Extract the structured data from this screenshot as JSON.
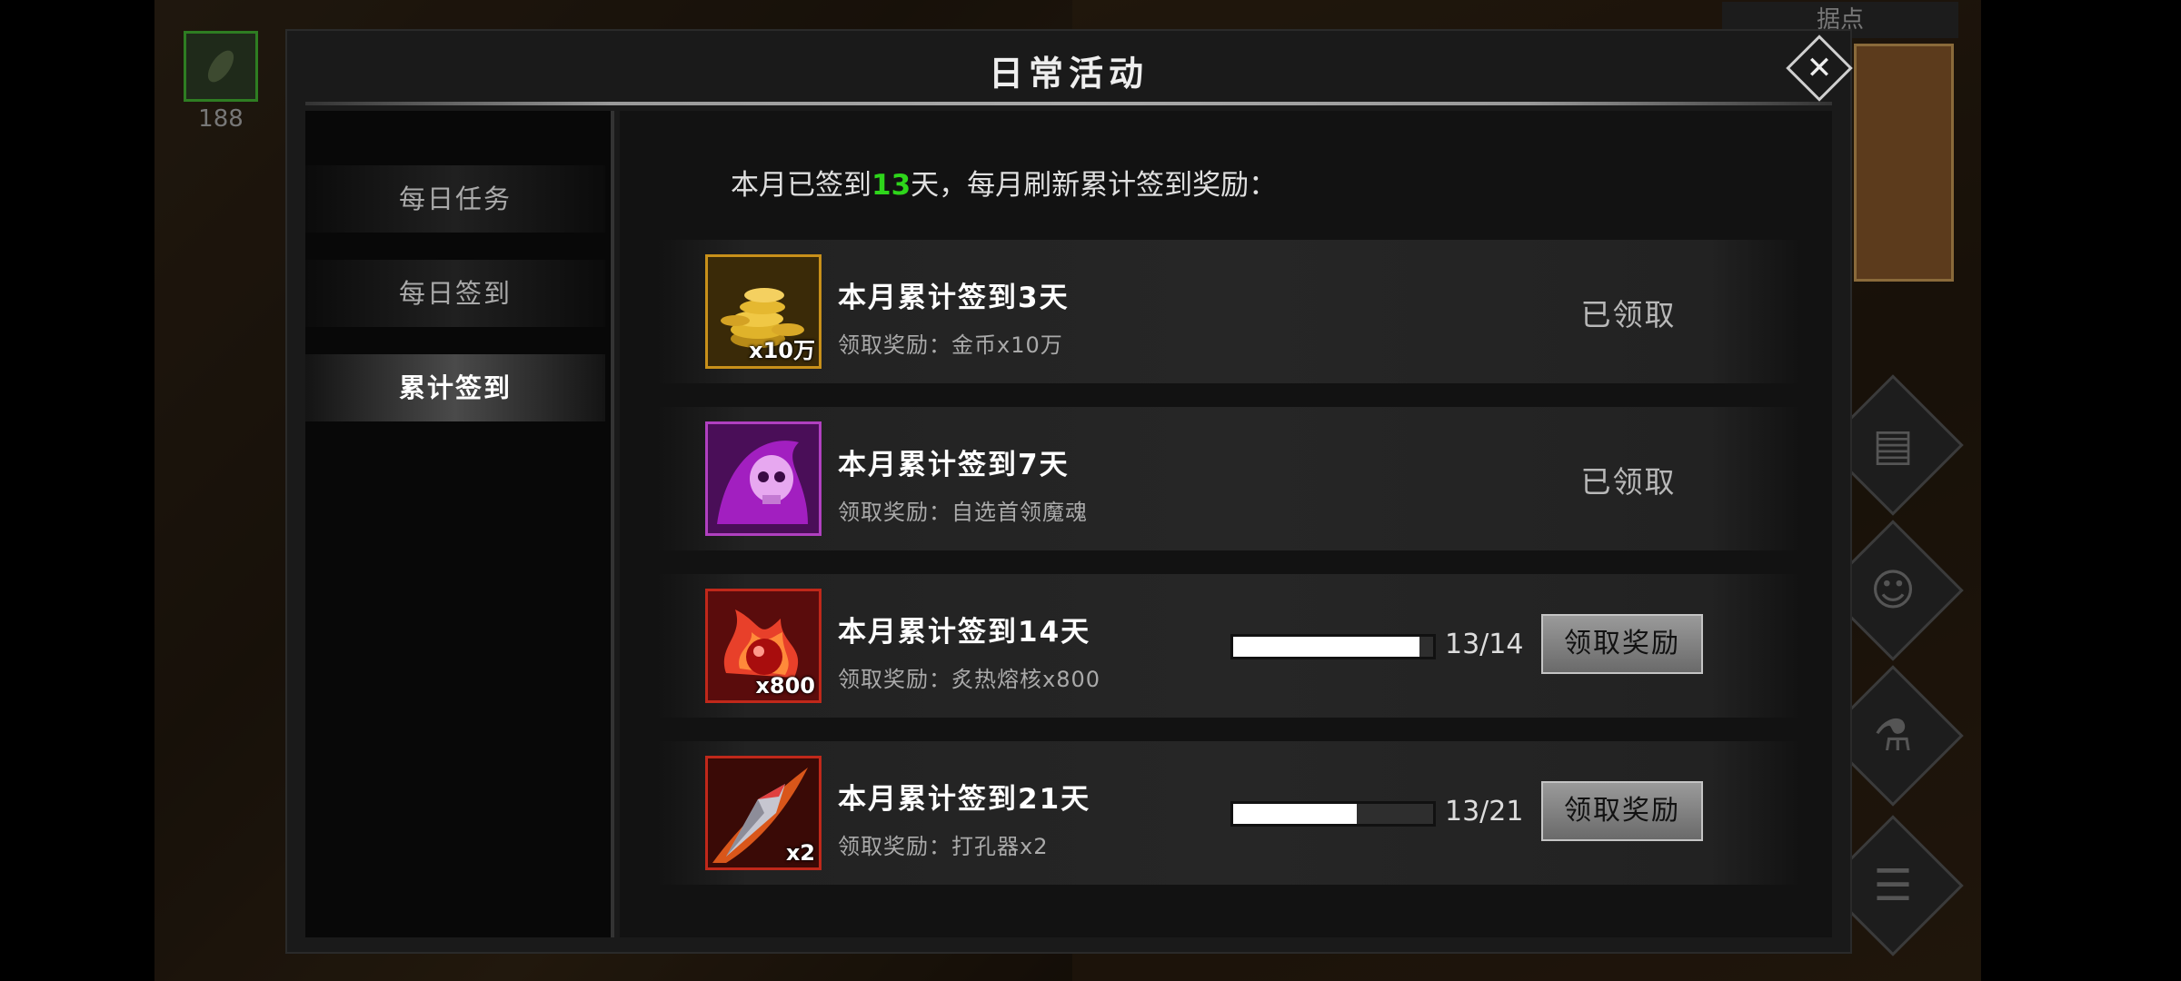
{
  "background": {
    "top_left_count": "188",
    "stronghold_label": "据点"
  },
  "dialog": {
    "title": "日常活动",
    "tabs": [
      {
        "label": "每日任务",
        "active": false
      },
      {
        "label": "每日签到",
        "active": false
      },
      {
        "label": "累计签到",
        "active": true
      }
    ],
    "summary": {
      "prefix": "本月已签到",
      "days": "13",
      "suffix": "天，每月刷新累计签到奖励："
    },
    "rewards": [
      {
        "title": "本月累计签到3天",
        "desc": "领取奖励：金币x10万",
        "qty": "x10万",
        "icon": "gold-coins-icon",
        "status": "已领取",
        "claimed": true
      },
      {
        "title": "本月累计签到7天",
        "desc": "领取奖励：自选首领魔魂",
        "qty": "",
        "icon": "skull-soul-icon",
        "status": "已领取",
        "claimed": true
      },
      {
        "title": "本月累计签到14天",
        "desc": "领取奖励：炙热熔核x800",
        "qty": "x800",
        "icon": "fire-core-icon",
        "progress_text": "13/14",
        "progress": 0.93,
        "button": "领取奖励",
        "claimed": false
      },
      {
        "title": "本月累计签到21天",
        "desc": "领取奖励：打孔器x2",
        "qty": "x2",
        "icon": "drill-blade-icon",
        "progress_text": "13/21",
        "progress": 0.62,
        "button": "领取奖励",
        "claimed": false
      }
    ]
  },
  "colors": {
    "highlight_green": "#2ed51b",
    "gold_border": "#c8901a",
    "purple_border": "#b040c0",
    "red_border": "#c0281a"
  }
}
